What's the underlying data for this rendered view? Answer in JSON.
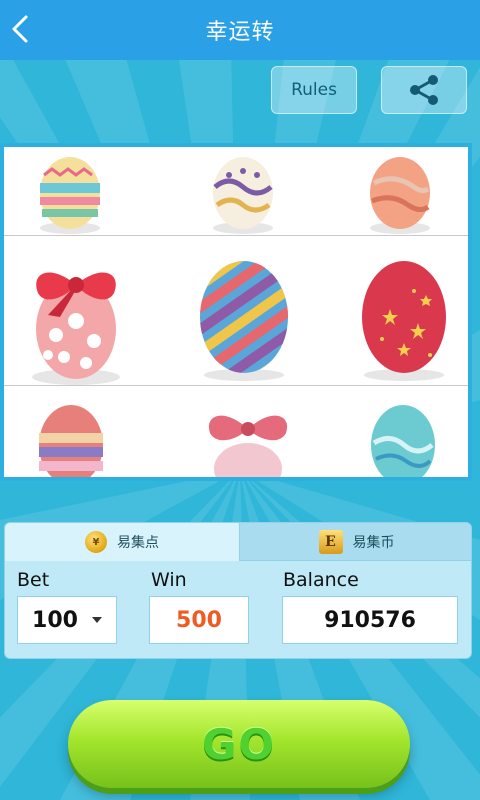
{
  "header": {
    "title": "幸运转"
  },
  "actions": {
    "rules_label": "Rules"
  },
  "icons": {
    "back": "chevron-left-icon",
    "share": "share-icon",
    "coin": "coin-icon",
    "epoint": "epoint-icon"
  },
  "tabs": [
    {
      "label": "易集点"
    },
    {
      "label": "易集币"
    }
  ],
  "fields": {
    "bet_label": "Bet",
    "bet_value": "100",
    "win_label": "Win",
    "win_value": "500",
    "balance_label": "Balance",
    "balance_value": "910576"
  },
  "go_label": "GO",
  "colors": {
    "header": "#2aa0e6",
    "background": "#2fb6d8",
    "win_text": "#f05a23",
    "go": "#8bd32a"
  }
}
